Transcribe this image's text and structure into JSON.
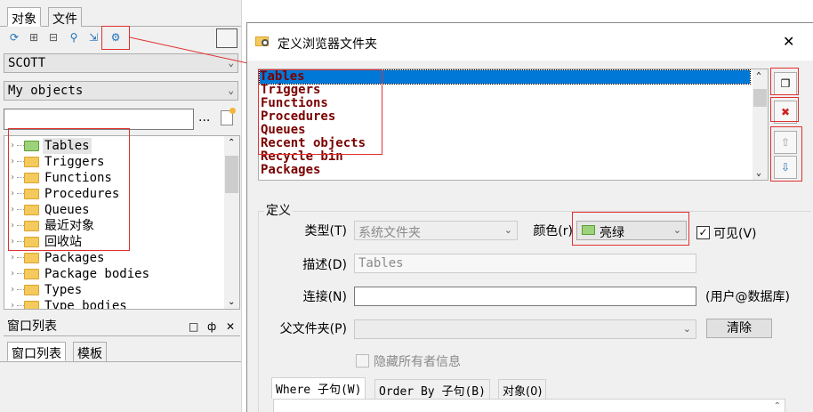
{
  "left_panel": {
    "tabs": [
      "对象",
      "文件"
    ],
    "toolbar_icons": [
      "refresh-icon",
      "expand-icon",
      "collapse-icon",
      "find-icon",
      "filter-icon",
      "folder-settings-icon"
    ],
    "owner_combo": "SCOTT",
    "filter_combo": "My objects",
    "search_value": "",
    "ellipsis": "...",
    "tree_items": [
      {
        "label": "Tables",
        "icon": "folder-open-green-icon"
      },
      {
        "label": "Triggers",
        "icon": "folder-icon"
      },
      {
        "label": "Functions",
        "icon": "folder-icon"
      },
      {
        "label": "Procedures",
        "icon": "folder-icon"
      },
      {
        "label": "Queues",
        "icon": "folder-icon"
      },
      {
        "label": "最近对象",
        "icon": "folder-icon"
      },
      {
        "label": "回收站",
        "icon": "folder-icon"
      },
      {
        "label": "Packages",
        "icon": "folder-icon"
      },
      {
        "label": "Package bodies",
        "icon": "folder-icon"
      },
      {
        "label": "Types",
        "icon": "folder-icon"
      },
      {
        "label": "Type bodies",
        "icon": "folder-icon"
      }
    ],
    "window_list_header": "窗口列表",
    "window_list_controls": [
      "□",
      "ф",
      "✕"
    ],
    "bottom_tabs": [
      "窗口列表",
      "模板"
    ]
  },
  "dialog": {
    "title": "定义浏览器文件夹",
    "close_label": "✕",
    "folders": [
      "Tables",
      "Triggers",
      "Functions",
      "Procedures",
      "Queues",
      "Recent objects",
      "Recycle bin",
      "Packages"
    ],
    "selected_index": 0,
    "definition_group_label": "定义",
    "type_label": "类型(T)",
    "type_value": "系统文件夹",
    "color_label": "颜色(r)",
    "color_value": "亮绿",
    "visible_label": "可见(V)",
    "visible_checked": true,
    "description_label": "描述(D)",
    "description_value": "Tables",
    "connection_label": "连接(N)",
    "connection_value": "",
    "connection_hint": "(用户@数据库)",
    "parent_folder_label": "父文件夹(P)",
    "parent_folder_value": "",
    "clear_button": "清除",
    "hide_owner_label": "隐藏所有者信息",
    "bottom_tabs": [
      "Where 子句(W)",
      "Order By 子句(B)",
      "对象(0)"
    ]
  },
  "colors": {
    "annotation_red": "#e0312f",
    "selection_blue": "#0078d7",
    "folder_text": "#7a0000"
  }
}
